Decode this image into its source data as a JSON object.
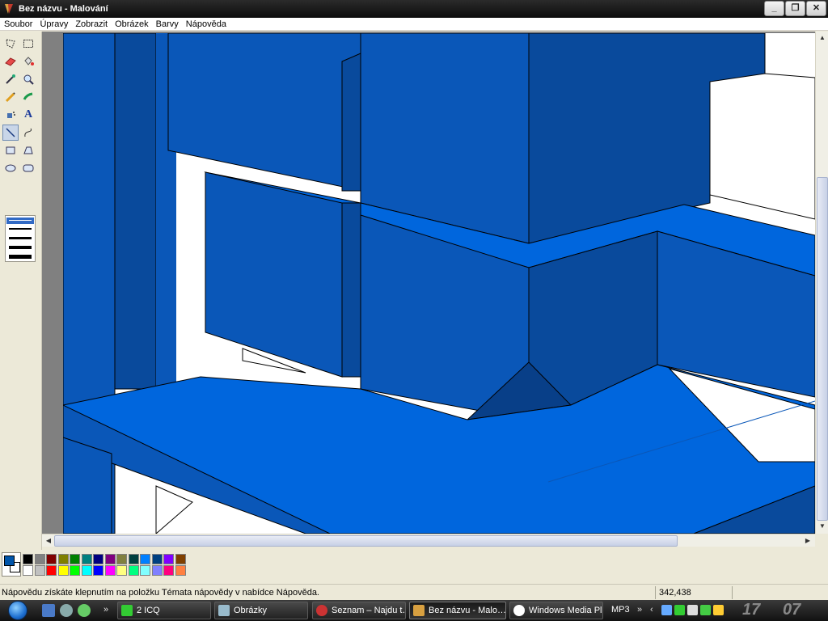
{
  "window": {
    "title": "Bez názvu - Malování",
    "minimize": "_",
    "maximize": "❐",
    "close": "✕"
  },
  "menu": [
    "Soubor",
    "Úpravy",
    "Zobrazit",
    "Obrázek",
    "Barvy",
    "Nápověda"
  ],
  "tools": [
    {
      "name": "free-select-icon",
      "glyph": "☆"
    },
    {
      "name": "rect-select-icon",
      "glyph": "⬚"
    },
    {
      "name": "eraser-icon",
      "glyph": "▰"
    },
    {
      "name": "fill-bucket-icon",
      "glyph": "◈"
    },
    {
      "name": "color-picker-icon",
      "glyph": "✎"
    },
    {
      "name": "magnifier-icon",
      "glyph": "⚲"
    },
    {
      "name": "pencil-icon",
      "glyph": "✏"
    },
    {
      "name": "brush-icon",
      "glyph": "🖌"
    },
    {
      "name": "airbrush-icon",
      "glyph": "✈"
    },
    {
      "name": "text-icon",
      "glyph": "A"
    },
    {
      "name": "line-icon",
      "glyph": "╲"
    },
    {
      "name": "curve-icon",
      "glyph": "∫"
    },
    {
      "name": "rectangle-icon",
      "glyph": "▭"
    },
    {
      "name": "polygon-icon",
      "glyph": "⏢"
    },
    {
      "name": "ellipse-icon",
      "glyph": "⬭"
    },
    {
      "name": "rounded-rect-icon",
      "glyph": "▢"
    }
  ],
  "active_tool": "line-icon",
  "colors": {
    "foreground": "#0055aa",
    "background": "#ffffff",
    "palette_top": [
      "#000000",
      "#808080",
      "#800000",
      "#808000",
      "#008000",
      "#008080",
      "#000080",
      "#800080",
      "#808040",
      "#004040",
      "#0080ff",
      "#004080",
      "#8000ff",
      "#804000"
    ],
    "palette_bottom": [
      "#ffffff",
      "#c0c0c0",
      "#ff0000",
      "#ffff00",
      "#00ff00",
      "#00ffff",
      "#0000ff",
      "#ff00ff",
      "#ffff80",
      "#00ff80",
      "#80ffff",
      "#8080ff",
      "#ff0080",
      "#ff8040"
    ],
    "drawing_blue": "#0066dd",
    "drawing_mid": "#0a57b8",
    "drawing_dark": "#094a9c"
  },
  "status": {
    "help": "Nápovědu získáte klepnutím na položku Témata nápovědy v nabídce Nápověda.",
    "coords": "342,438"
  },
  "taskbar": {
    "chevron": "»",
    "buttons": [
      {
        "label": "2 ICQ",
        "name": "task-icq"
      },
      {
        "label": "Obrázky",
        "name": "task-obrazky"
      },
      {
        "label": "Seznam – Najdu t…",
        "name": "task-seznam"
      },
      {
        "label": "Bez názvu - Malo…",
        "name": "task-paint"
      },
      {
        "label": "Windows Media Pl…",
        "name": "task-wmp"
      }
    ],
    "mp3": "MP3",
    "clock_h": "17",
    "clock_m": "07"
  }
}
